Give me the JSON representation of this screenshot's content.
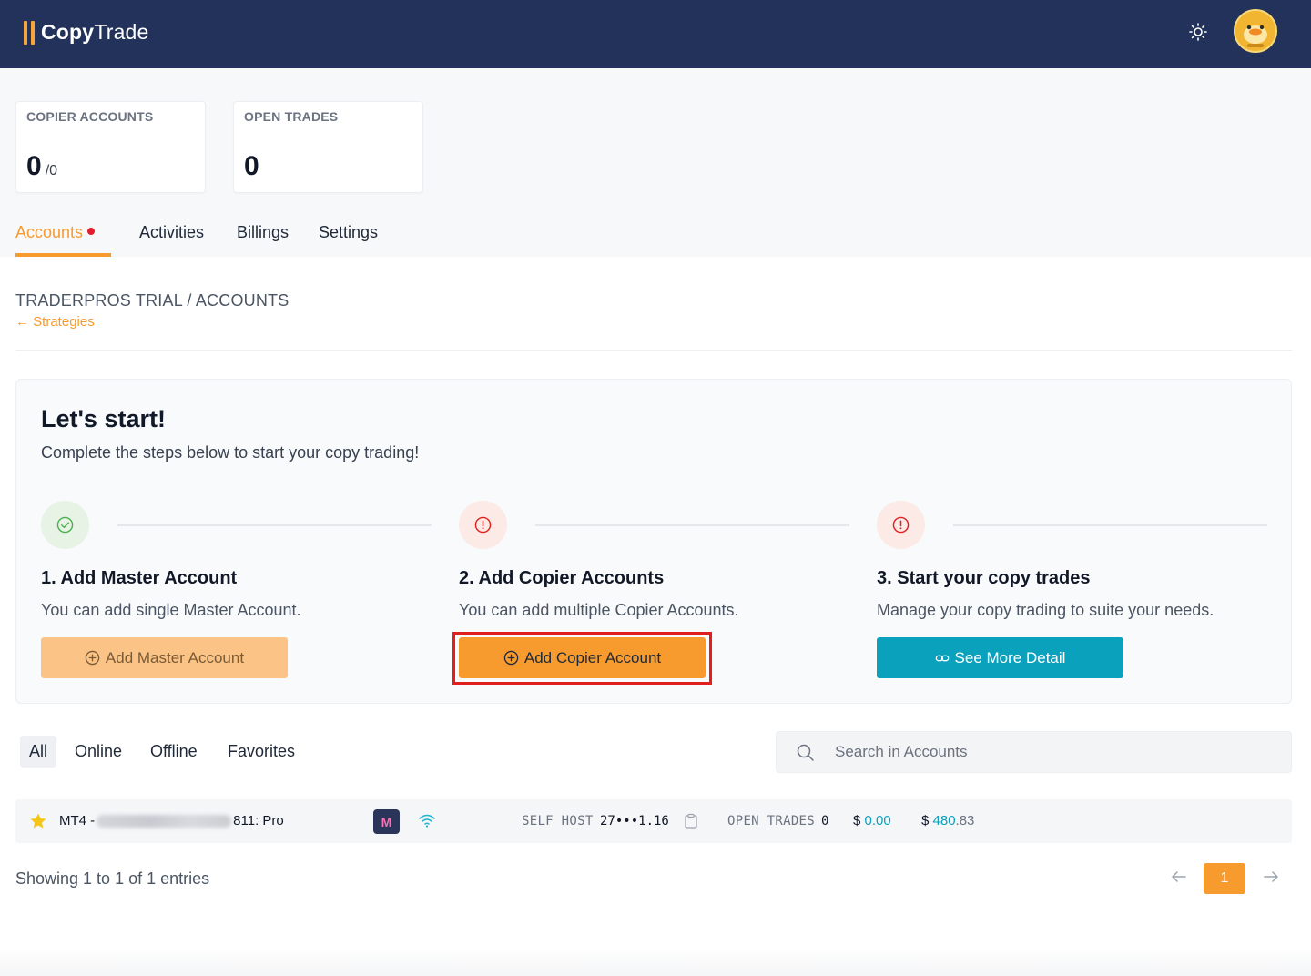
{
  "header": {
    "logo_bold": "Copy",
    "logo_light": "Trade",
    "theme_icon": "sun-icon",
    "avatar_icon": "duck-avatar"
  },
  "stats": [
    {
      "label": "COPIER ACCOUNTS",
      "value": "0",
      "sub": "/0"
    },
    {
      "label": "OPEN TRADES",
      "value": "0",
      "sub": ""
    }
  ],
  "tabs": [
    {
      "label": "Accounts",
      "active": true,
      "notification": true
    },
    {
      "label": "Activities"
    },
    {
      "label": "Billings"
    },
    {
      "label": "Settings"
    }
  ],
  "breadcrumb": {
    "path": "TRADERPROS TRIAL / ACCOUNTS",
    "back_label": "Strategies"
  },
  "start": {
    "title": "Let's start!",
    "subtitle": "Complete the steps below to start your copy trading!",
    "steps": [
      {
        "status": "done",
        "title": "1. Add Master Account",
        "desc": "You can add single Master Account.",
        "button": "Add Master Account"
      },
      {
        "status": "todo",
        "title": "2. Add Copier Accounts",
        "desc": "You can add multiple Copier Accounts.",
        "button": "Add Copier Account"
      },
      {
        "status": "todo",
        "title": "3. Start your copy trades",
        "desc": "Manage your copy trading to suite your needs.",
        "button": "See More Detail"
      }
    ]
  },
  "filters": [
    "All",
    "Online",
    "Offline",
    "Favorites"
  ],
  "search": {
    "placeholder": "Search in Accounts"
  },
  "account": {
    "prefix": "MT4 -",
    "suffix": "811: Pro",
    "badge": "M",
    "host_label": "SELF HOST",
    "host_value": "27•••1.16",
    "trades_label": "OPEN TRADES",
    "trades_value": "0",
    "money1_symbol": "$",
    "money1_value": "0.00",
    "money2_symbol": "$",
    "money2_int": "480",
    "money2_dec": ".83"
  },
  "pagination": {
    "showing": "Showing 1 to 1 of 1 entries",
    "page": "1"
  },
  "colors": {
    "header_bg": "#22325a",
    "accent": "#f79b2e",
    "teal": "#0aa1bd",
    "highlight": "#e0201e"
  }
}
